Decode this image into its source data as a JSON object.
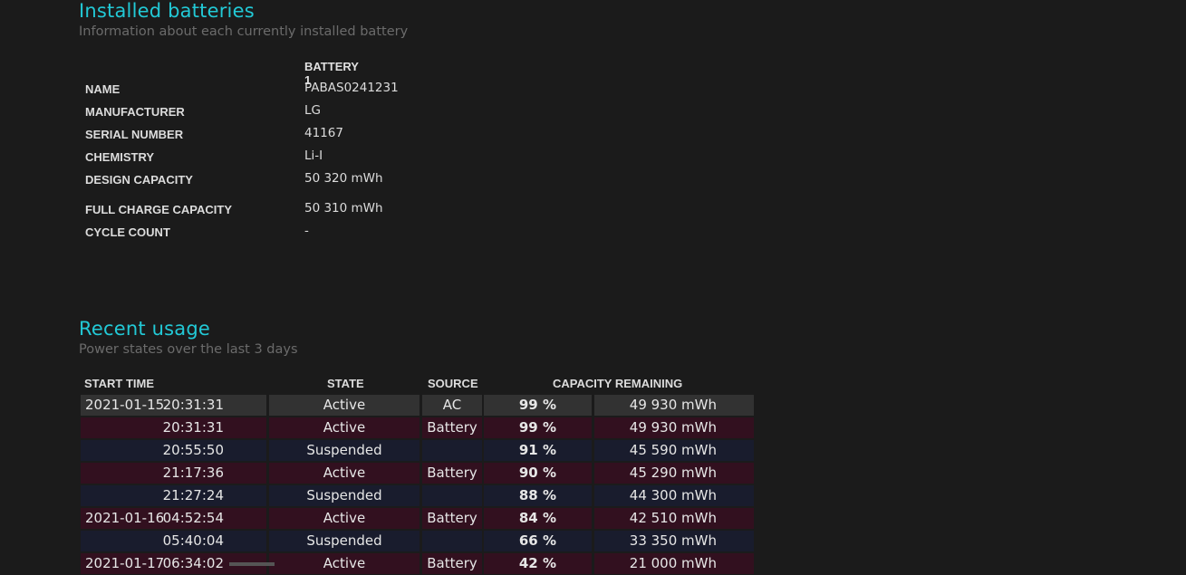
{
  "installed": {
    "title": "Installed batteries",
    "subtitle": "Information about each currently installed battery",
    "column_header": "BATTERY 1",
    "rows": [
      {
        "label": "NAME",
        "value": "PABAS0241231"
      },
      {
        "label": "MANUFACTURER",
        "value": "LG"
      },
      {
        "label": "SERIAL NUMBER",
        "value": "41167"
      },
      {
        "label": "CHEMISTRY",
        "value": "Li-I"
      },
      {
        "label": "DESIGN CAPACITY",
        "value": "50 320 mWh"
      },
      {
        "label": "FULL CHARGE CAPACITY",
        "value": "50 310 mWh"
      },
      {
        "label": "CYCLE COUNT",
        "value": "-"
      }
    ]
  },
  "usage": {
    "title": "Recent usage",
    "subtitle": "Power states over the last 3 days",
    "headers": {
      "start_time": "START TIME",
      "state": "STATE",
      "source": "SOURCE",
      "capacity": "CAPACITY REMAINING"
    },
    "rows": [
      {
        "date": "2021-01-15",
        "time": "20:31:31",
        "state": "Active",
        "source": "AC",
        "pct": "99 %",
        "mwh": "49 930 mWh",
        "kind": "ac"
      },
      {
        "date": "",
        "time": "20:31:31",
        "state": "Active",
        "source": "Battery",
        "pct": "99 %",
        "mwh": "49 930 mWh",
        "kind": "bat"
      },
      {
        "date": "",
        "time": "20:55:50",
        "state": "Suspended",
        "source": "",
        "pct": "91 %",
        "mwh": "45 590 mWh",
        "kind": "sus"
      },
      {
        "date": "",
        "time": "21:17:36",
        "state": "Active",
        "source": "Battery",
        "pct": "90 %",
        "mwh": "45 290 mWh",
        "kind": "bat"
      },
      {
        "date": "",
        "time": "21:27:24",
        "state": "Suspended",
        "source": "",
        "pct": "88 %",
        "mwh": "44 300 mWh",
        "kind": "sus"
      },
      {
        "date": "2021-01-16",
        "time": "04:52:54",
        "state": "Active",
        "source": "Battery",
        "pct": "84 %",
        "mwh": "42 510 mWh",
        "kind": "bat"
      },
      {
        "date": "",
        "time": "05:40:04",
        "state": "Suspended",
        "source": "",
        "pct": "66 %",
        "mwh": "33 350 mWh",
        "kind": "sus"
      },
      {
        "date": "2021-01-17",
        "time": "06:34:02",
        "state": "Active",
        "source": "Battery",
        "pct": "42 %",
        "mwh": "21 000 mWh",
        "kind": "bat"
      }
    ]
  }
}
